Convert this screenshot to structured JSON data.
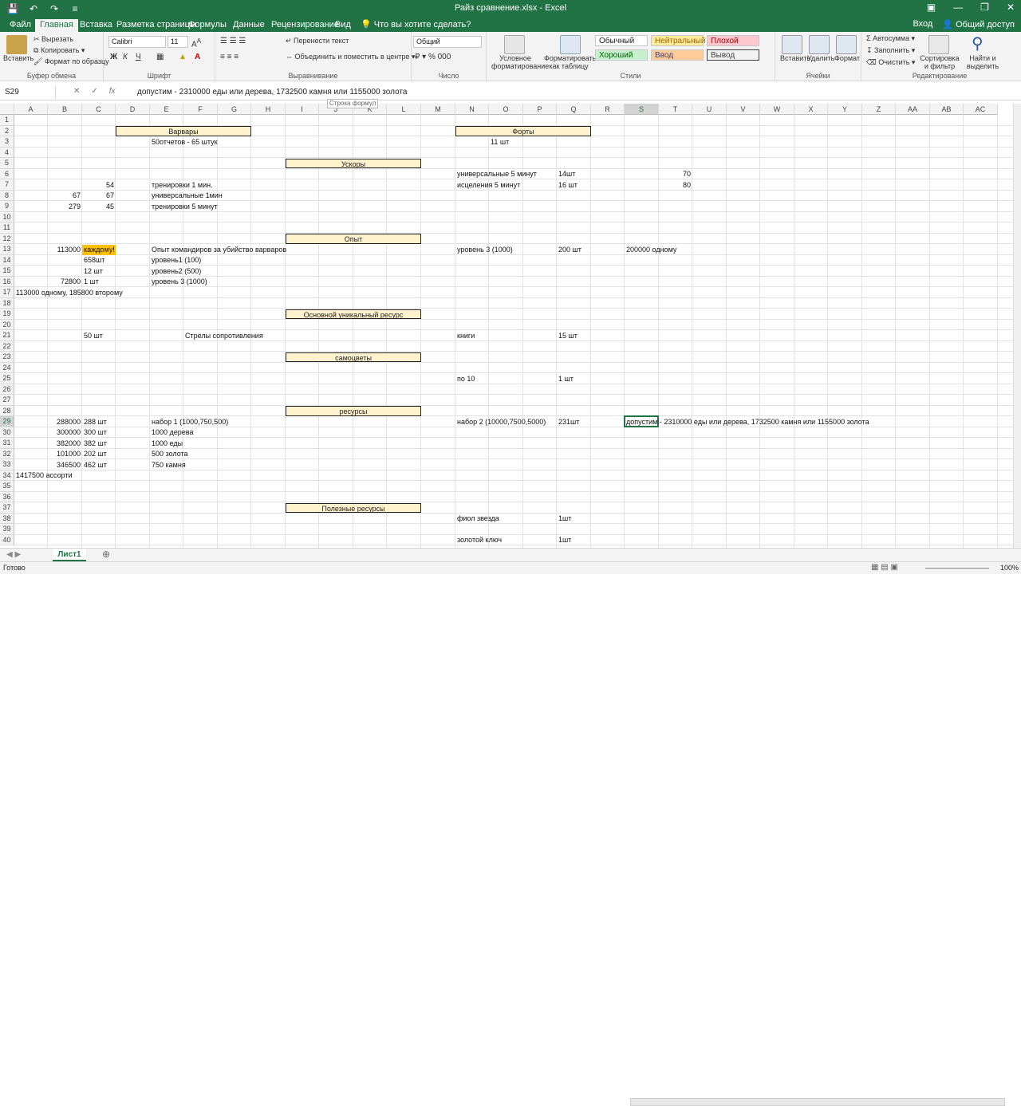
{
  "window": {
    "title": "Райз сравнение.xlsx - Excel",
    "qat": [
      "save-icon",
      "undo-icon",
      "redo-icon",
      "customize-icon"
    ]
  },
  "tabs": [
    "Файл",
    "Главная",
    "Вставка",
    "Разметка страницы",
    "Формулы",
    "Данные",
    "Рецензирование",
    "Вид"
  ],
  "tell_me": "Что вы хотите сделать?",
  "account": {
    "signin": "Вход",
    "share": "Общий доступ"
  },
  "ribbon": {
    "clipboard": {
      "paste": "Вставить",
      "cut": "Вырезать",
      "copy": "Копировать",
      "format_painter": "Формат по образцу",
      "label": "Буфер обмена"
    },
    "font": {
      "name": "Calibri",
      "size": "11",
      "label": "Шрифт"
    },
    "alignment": {
      "wrap": "Перенести текст",
      "merge": "Объединить и поместить в центре",
      "label": "Выравнивание"
    },
    "number": {
      "format": "Общий",
      "label": "Число"
    },
    "styles": {
      "conditional": "Условное форматирование",
      "as_table": "Форматировать как таблицу",
      "normal": "Обычный",
      "neutral": "Нейтральный",
      "bad": "Плохой",
      "good": "Хороший",
      "input": "Ввод",
      "output": "Вывод",
      "label": "Стили"
    },
    "cells": {
      "insert": "Вставить",
      "delete": "Удалить",
      "format": "Формат",
      "label": "Ячейки"
    },
    "editing": {
      "autosum": "Автосумма",
      "fill": "Заполнить",
      "clear": "Очистить",
      "sort": "Сортировка и фильтр",
      "find": "Найти и выделить",
      "label": "Редактирование"
    }
  },
  "formula_bar": {
    "name_box": "S29",
    "content": "допустим - 2310000 еды или дерева, 1732500 камня или 1155000 золота",
    "tooltip": "Строка формул"
  },
  "columns": [
    "A",
    "B",
    "C",
    "D",
    "E",
    "F",
    "G",
    "H",
    "I",
    "J",
    "K",
    "L",
    "M",
    "N",
    "O",
    "P",
    "Q",
    "R",
    "S",
    "T",
    "U",
    "V",
    "W",
    "X",
    "Y",
    "Z",
    "AA",
    "AB",
    "AC"
  ],
  "rows": [
    "1",
    "2",
    "3",
    "4",
    "5",
    "6",
    "7",
    "8",
    "9",
    "10",
    "11",
    "12",
    "13",
    "14",
    "15",
    "16",
    "17",
    "18",
    "19",
    "20",
    "21",
    "22",
    "23",
    "24",
    "25",
    "26",
    "27",
    "28",
    "29",
    "30",
    "31",
    "32",
    "33",
    "34",
    "35",
    "36",
    "37",
    "38",
    "39",
    "40"
  ],
  "headers": {
    "barbarians": "Варвары",
    "forts": "Форты",
    "speedups": "Ускоры",
    "experience": "Опыт",
    "unique": "Основной уникальный ресурс",
    "gems": "самоцветы",
    "resources": "ресурсы",
    "useful": "Полезные ресурсы"
  },
  "cells": {
    "e3": "50отчетов - 65 штук",
    "o3": "11 шт",
    "n6": "универсальные 5 минут",
    "q6": "14шт",
    "t6": "70",
    "c7": "54",
    "e7": "тренировки 1 мин.",
    "n7": "исцеления 5 минут",
    "q7": "16 шт",
    "t7": "80",
    "b8": "67",
    "c8": "67",
    "e8": "универсальные 1мин",
    "b9": "279",
    "c9": "45",
    "e9": "тренировки 5 минут",
    "b13": "113000",
    "c13": "каждому!",
    "e13": "Опыт командиров за убийство варваров",
    "n13": "уровень 3 (1000)",
    "q13": "200 шт",
    "s13": "200000 одному",
    "c14": "658шт",
    "e14": "уровень1 (100)",
    "c15": "12 шт",
    "e15": "уровень2 (500)",
    "b16": "72800",
    "c16": "1 шт",
    "e16": "уровень 3 (1000)",
    "a17": "113000 одному, 185800 второму",
    "c21": "50 шт",
    "f21": "Стрелы сопротивления",
    "n21": "книги",
    "q21": "15 шт",
    "n25": "по 10",
    "q25": "1 шт",
    "b29": "288000",
    "c29": "288 шт",
    "e29": "набор 1 (1000,750,500)",
    "n29": "набор 2 (10000,7500,5000)",
    "q29": "231шт",
    "s29": "допустим - 2310000 еды или дерева, 1732500 камня или 1155000 золота",
    "b30": "300000",
    "c30": "300 шт",
    "e30": "1000 дерева",
    "b31": "382000",
    "c31": "382 шт",
    "e31": "1000 еды",
    "b32": "101000",
    "c32": "202 шт",
    "e32": "500 золота",
    "b33": "346500",
    "c33": "462 шт",
    "e33": "750 камня",
    "a34": "1417500 ассорти",
    "n38": "фиол звезда",
    "q38": "1шт",
    "n40": "золотой ключ",
    "q40": "1шт"
  },
  "sheet": {
    "name": "Лист1"
  },
  "status": {
    "ready": "Готово",
    "zoom": "100%"
  }
}
